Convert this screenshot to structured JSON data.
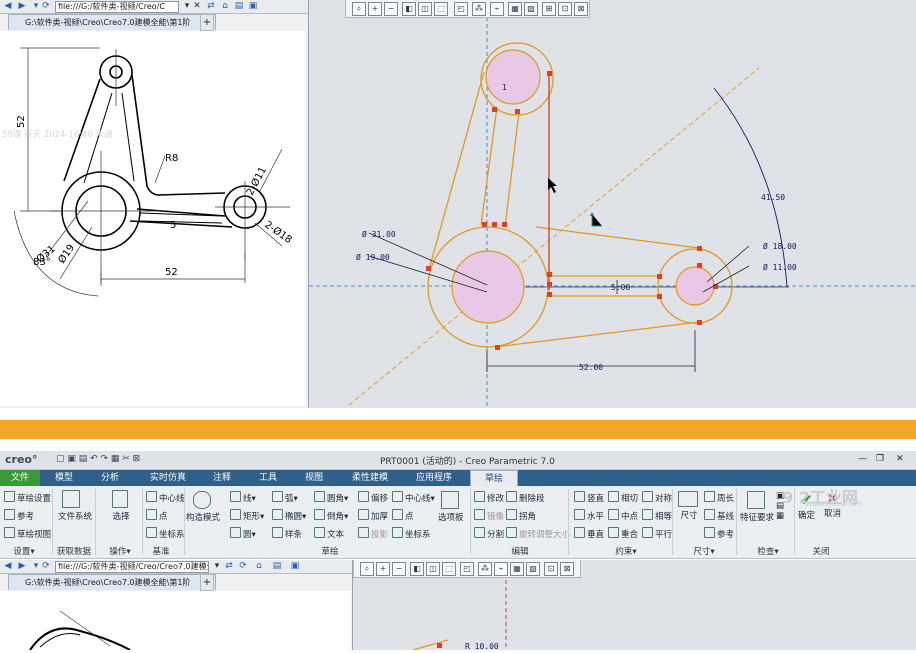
{
  "top": {
    "address": "file:///G:/软件类-视频/Creo/C",
    "tab_label": "G:\\软件类-视频\\Creo\\Creo7.0建模全能\\第1阶",
    "drawing_dims": [
      "52",
      "R8",
      "2-Ø11",
      "Ø31",
      "Ø19",
      "5",
      "2-Ø18",
      "83°",
      "52"
    ],
    "watermark": "58课 开天 2024-16:40 未通",
    "sketch_dims": {
      "d31": "Ø 31.00",
      "d19": "Ø 19.00",
      "d18": "Ø 18.00",
      "d11": "Ø 11.00",
      "gap": "5.00",
      "dist": "52.00",
      "angle": "41.50",
      "r": "1"
    }
  },
  "app": {
    "logo": "creo°",
    "window_title": "PRT0001 (活动的) - Creo Parametric 7.0",
    "tabs": [
      "文件",
      "模型",
      "分析",
      "实时仿真",
      "注释",
      "工具",
      "视图",
      "柔性建模",
      "应用程序",
      "草绘"
    ],
    "groups": {
      "setup": {
        "items": [
          "草绘设置",
          "参考",
          "草绘视图"
        ],
        "label": "设置▾"
      },
      "get_data": {
        "items": [
          "文件系统"
        ],
        "label": "获取数据"
      },
      "operations": {
        "items": [
          "选择"
        ],
        "label": "操作▾"
      },
      "datum": {
        "items": [
          "中心线",
          "点",
          "坐标系"
        ],
        "label": "基准"
      },
      "sketch": {
        "items": [
          "构造模式",
          "线▾",
          "弧▾",
          "圆角▾",
          "偏移",
          "中心线▾",
          "矩形▾",
          "椭圆▾",
          "倒角▾",
          "加厚",
          "点",
          "圆▾",
          "样条",
          "文本",
          "投影",
          "坐标系",
          "选项板"
        ],
        "label": "草绘"
      },
      "edit": {
        "items": [
          "修改",
          "删除段",
          "镜像",
          "拐角",
          "分割",
          "旋转调整大小"
        ],
        "label": "编辑"
      },
      "constrain": {
        "items": [
          "竖直",
          "相切",
          "对称",
          "水平",
          "中点",
          "相等",
          "垂直",
          "重合",
          "平行"
        ],
        "label": "约束▾"
      },
      "dimension": {
        "items": [
          "尺寸",
          "周长",
          "基线",
          "参考"
        ],
        "label": "尺寸▾"
      },
      "inspect": {
        "items": [
          "特征要求"
        ],
        "label": "检查▾"
      },
      "close": {
        "items": [
          "确定",
          "取消"
        ],
        "label": "关闭"
      }
    },
    "watermark_logo": "9 2工业网",
    "watermark_url": "www.9ptvv.com"
  },
  "bottom": {
    "address": "file:///G:/软件类-视频/Creo/Creo7.0建模全能",
    "tab_label": "G:\\软件类-视频\\Creo\\Creo7.0建模全能\\第1阶",
    "sketch_label": "R 10.00"
  }
}
